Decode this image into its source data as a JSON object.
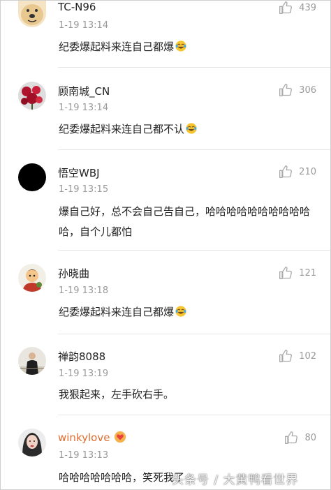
{
  "comments": [
    {
      "username": "TC-N96",
      "time": "1-19 13:14",
      "text": "纪委爆起料来连自己都爆",
      "emoji": "laugh-cry-emoji",
      "likes": "439"
    },
    {
      "username": "顾南城_CN",
      "time": "1-19 13:14",
      "text": "纪委爆起料来连自己都不认",
      "emoji": "laugh-cry-emoji",
      "likes": "306"
    },
    {
      "username": "悟空WBJ",
      "time": "1-19 13:15",
      "text": "爆自己好，总不会自己告自己，哈哈哈哈哈哈哈哈哈哈哈，自个儿都怕",
      "likes": "210"
    },
    {
      "username": "孙晓曲",
      "time": "1-19 13:18",
      "text": "纪委爆起料来连自己都爆",
      "emoji": "laugh-cry-emoji",
      "likes": "121"
    },
    {
      "username": "禅韵8088",
      "time": "1-19 13:19",
      "text": "我狠起来，左手砍右手。",
      "likes": "102"
    },
    {
      "username": "winkylove",
      "time": "1-19 13:13",
      "text": "哈哈哈哈哈哈哈，笑死我了",
      "likes": "80",
      "badge": "vip-heart-badge"
    }
  ],
  "watermark": "头条号 / 大黄鸭看世界",
  "colors": {
    "text": "#222222",
    "meta": "#9a9a9a",
    "vip_name": "#e06b2b",
    "divider": "#e6e6e6"
  }
}
